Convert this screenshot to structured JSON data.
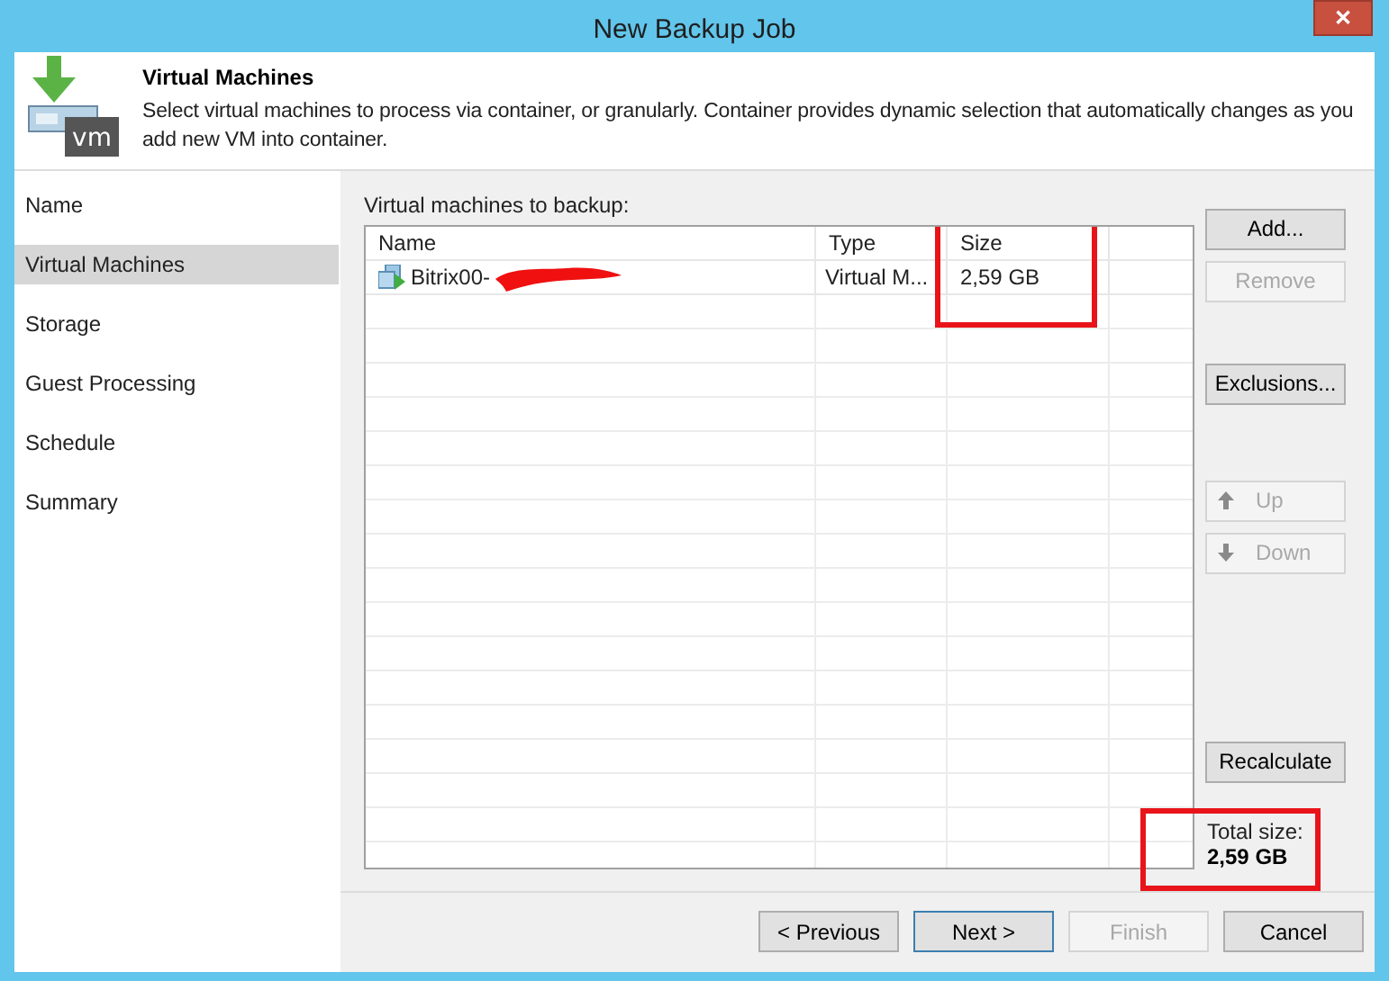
{
  "window": {
    "title": "New Backup Job",
    "close": "✕"
  },
  "header": {
    "icon_text": "vm",
    "title": "Virtual Machines",
    "description": "Select virtual machines to process via container, or granularly. Container provides dynamic selection that automatically changes as you add new VM into container."
  },
  "sidebar": {
    "items": [
      {
        "label": "Name",
        "selected": false
      },
      {
        "label": "Virtual Machines",
        "selected": true
      },
      {
        "label": "Storage",
        "selected": false
      },
      {
        "label": "Guest Processing",
        "selected": false
      },
      {
        "label": "Schedule",
        "selected": false
      },
      {
        "label": "Summary",
        "selected": false
      }
    ]
  },
  "table": {
    "label": "Virtual machines to backup:",
    "columns": [
      "Name",
      "Type",
      "Size"
    ],
    "rows": [
      {
        "name": "Bitrix00-",
        "type": "Virtual M...",
        "size": "2,59 GB"
      }
    ]
  },
  "side_buttons": [
    {
      "kind": "plain",
      "label": "Add...",
      "disabled": false
    },
    {
      "kind": "plain",
      "label": "Remove",
      "disabled": true
    },
    {
      "kind": "gap"
    },
    {
      "kind": "plain",
      "label": "Exclusions...",
      "disabled": false
    },
    {
      "kind": "gap"
    },
    {
      "kind": "up",
      "label": "Up",
      "disabled": true
    },
    {
      "kind": "down",
      "label": "Down",
      "disabled": true
    }
  ],
  "recalculate": {
    "label": "Recalculate"
  },
  "total": {
    "label": "Total size:",
    "value": "2,59 GB"
  },
  "footer_buttons": [
    {
      "label": "< Previous",
      "disabled": false,
      "default": false
    },
    {
      "label": "Next >",
      "disabled": false,
      "default": true
    },
    {
      "label": "Finish",
      "disabled": true,
      "default": false
    },
    {
      "label": "Cancel",
      "disabled": false,
      "default": false
    }
  ]
}
